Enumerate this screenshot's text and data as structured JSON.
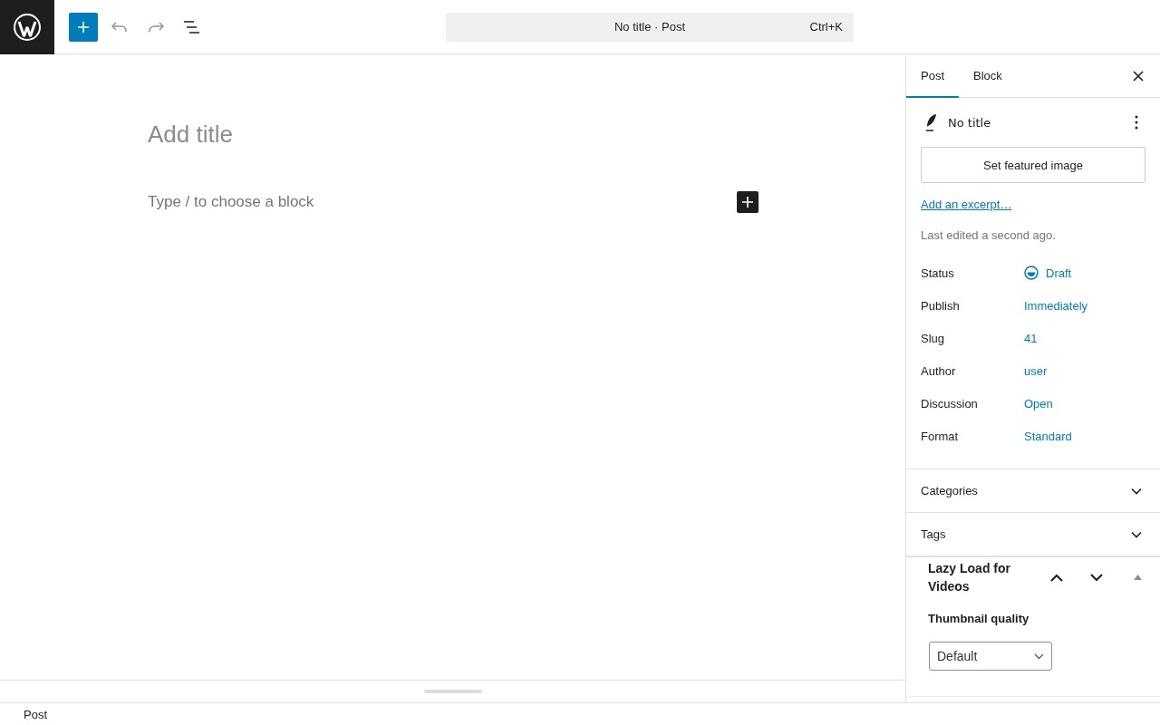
{
  "command_bar": {
    "title": "No title · Post",
    "shortcut": "Ctrl+K"
  },
  "editor": {
    "title_placeholder": "Add title",
    "block_placeholder": "Type / to choose a block"
  },
  "tabs": [
    {
      "label": "Post",
      "selected": true
    },
    {
      "label": "Block",
      "selected": false
    }
  ],
  "post_summary": {
    "title": "No title",
    "featured_button": "Set featured image",
    "excerpt_link": "Add an excerpt…",
    "last_edited": "Last edited a second ago."
  },
  "fields": [
    {
      "label": "Status",
      "value": "Draft",
      "kind": "status"
    },
    {
      "label": "Publish",
      "value": "Immediately",
      "kind": "link"
    },
    {
      "label": "Slug",
      "value": "41",
      "kind": "link"
    },
    {
      "label": "Author",
      "value": "user",
      "kind": "link"
    },
    {
      "label": "Discussion",
      "value": "Open",
      "kind": "link"
    },
    {
      "label": "Format",
      "value": "Standard",
      "kind": "link"
    }
  ],
  "panels": [
    {
      "title": "Categories",
      "expanded": false
    },
    {
      "title": "Tags",
      "expanded": false
    }
  ],
  "lazy_load": {
    "title": "Lazy Load for Videos",
    "expanded": true,
    "field_label": "Thumbnail quality",
    "select_value": "Default"
  },
  "footer": {
    "breadcrumb": "Post"
  }
}
